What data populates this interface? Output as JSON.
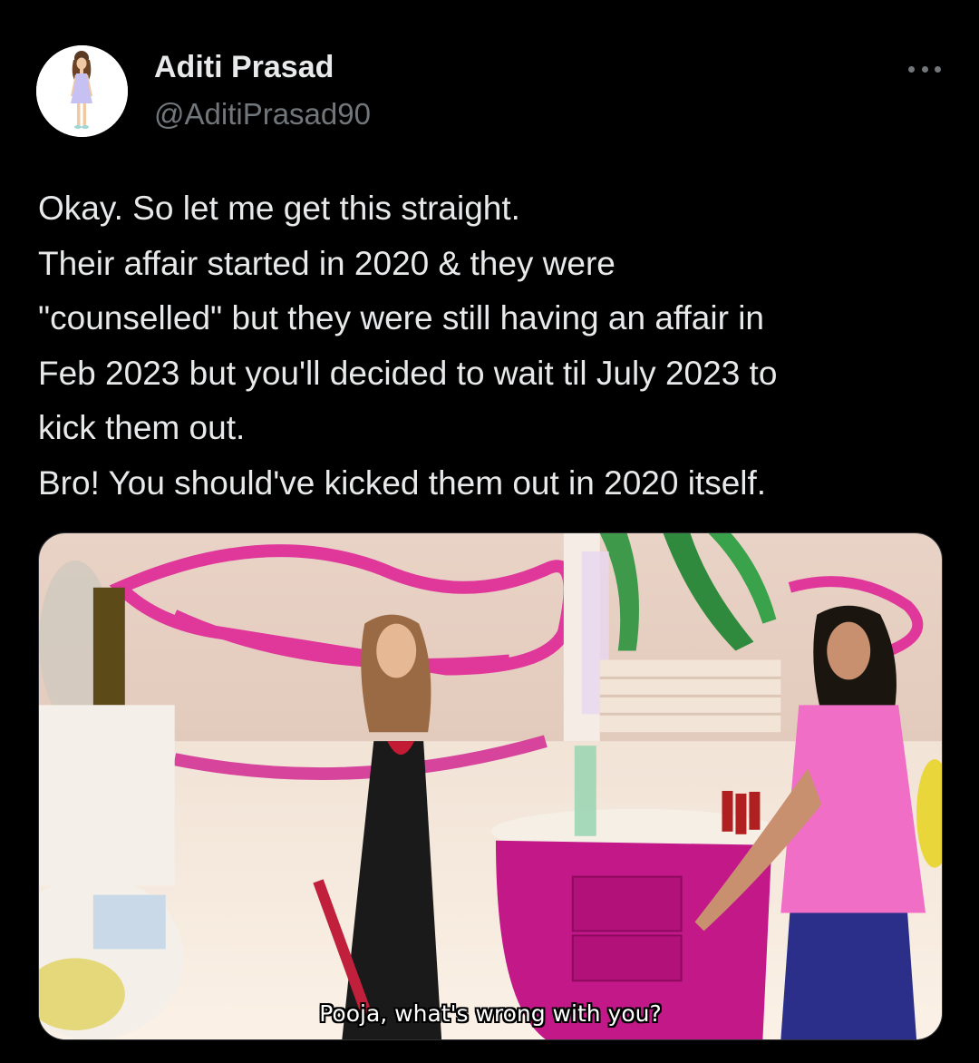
{
  "author": {
    "name": "Aditi Prasad",
    "handle": "@AditiPrasad90",
    "avatar_icon": "cartoon-girl-avatar"
  },
  "more_icon": "ellipsis-icon",
  "tweet": {
    "lines": [
      "Okay. So let me get this straight.",
      "Their affair started in 2020 & they were",
      "\"counselled\" but they were still having an affair in",
      "Feb 2023 but you'll decided to wait til July 2023 to",
      "kick them out.",
      "Bro! You should've kicked them out in 2020 itself."
    ]
  },
  "media": {
    "subtitle": "Pooja, what's wrong with you?"
  },
  "colors": {
    "background": "#000000",
    "text_primary": "#e7e9ea",
    "text_secondary": "#71767b",
    "media_border": "#2f3336"
  }
}
